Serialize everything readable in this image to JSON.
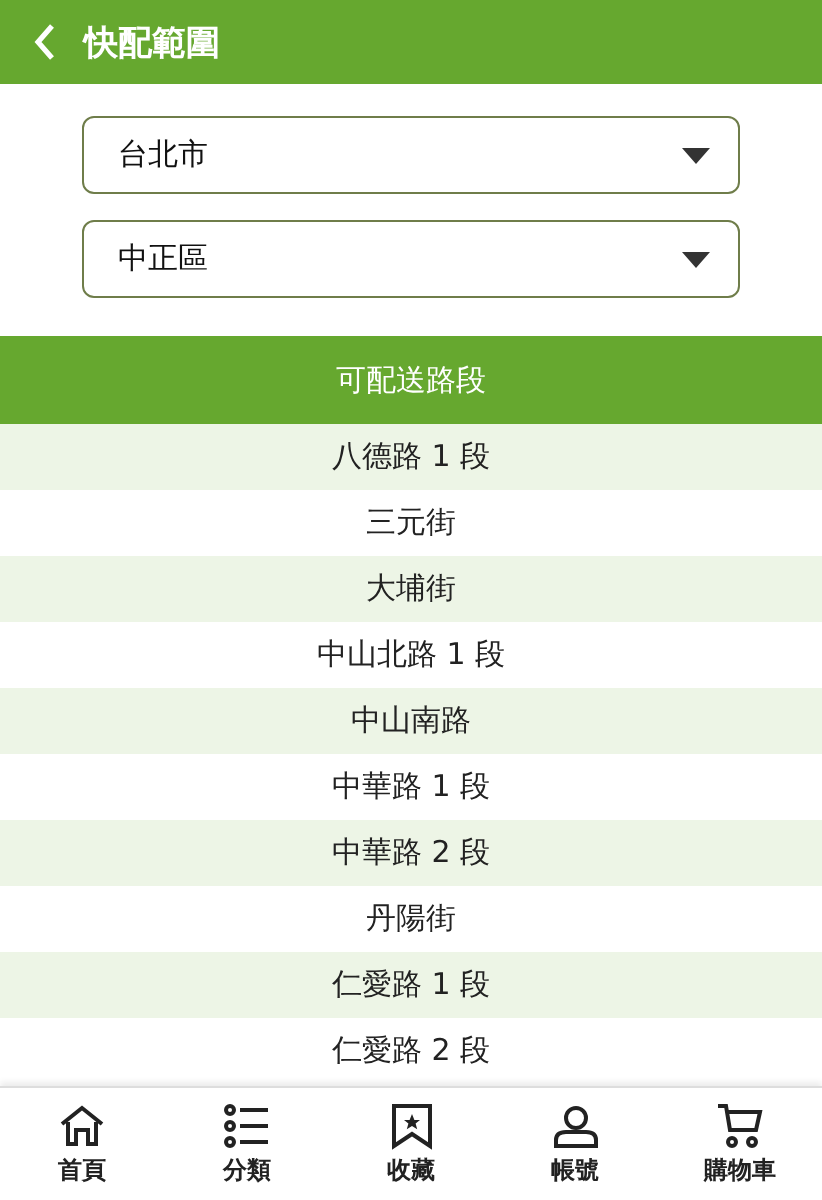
{
  "header": {
    "title": "快配範圍"
  },
  "selects": [
    {
      "value": "台北市"
    },
    {
      "value": "中正區"
    }
  ],
  "table": {
    "heading": "可配送路段",
    "rows": [
      "八德路 1 段",
      "三元街",
      "大埔街",
      "中山北路 1 段",
      "中山南路",
      "中華路 1 段",
      "中華路 2 段",
      "丹陽街",
      "仁愛路 1 段",
      "仁愛路 2 段"
    ]
  },
  "nav": [
    {
      "kind": "home",
      "label": "首頁"
    },
    {
      "kind": "list",
      "label": "分類"
    },
    {
      "kind": "bookmark",
      "label": "收藏"
    },
    {
      "kind": "user",
      "label": "帳號"
    },
    {
      "kind": "cart",
      "label": "購物車"
    }
  ]
}
